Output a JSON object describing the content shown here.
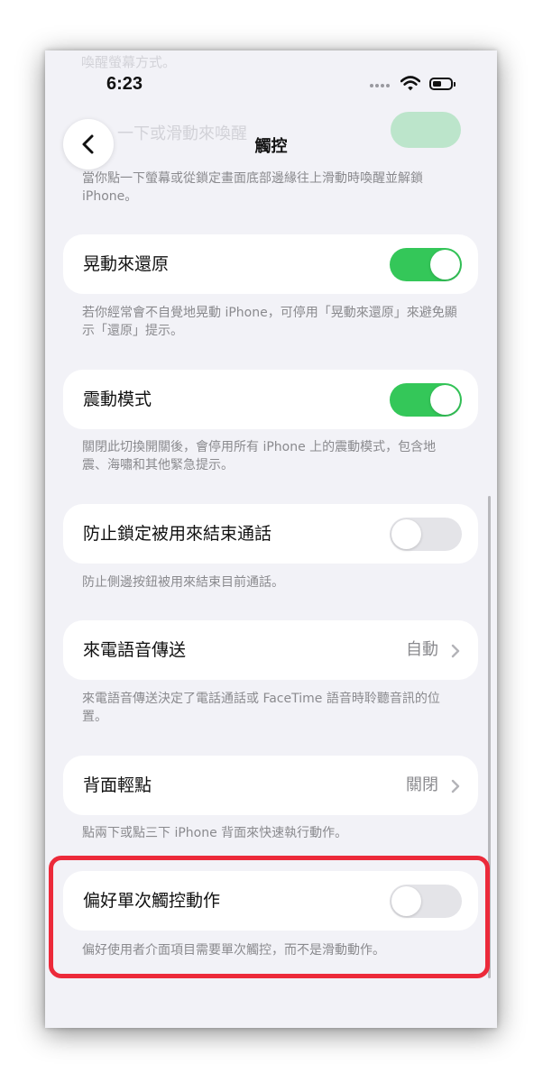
{
  "status_bar": {
    "time": "6:23"
  },
  "nav": {
    "title": "觸控"
  },
  "background_ghost": {
    "line1": "喚醒螢幕方式。",
    "line2": "一下或滑動來喚醒"
  },
  "wake_footer": "當你點一下螢幕或從鎖定畫面底部邊緣往上滑動時喚醒並解鎖 iPhone。",
  "settings": [
    {
      "label": "晃動來還原",
      "control": "toggle",
      "on": true,
      "footer": "若你經常會不自覺地晃動 iPhone，可停用「晃動來還原」來避免顯示「還原」提示。"
    },
    {
      "label": "震動模式",
      "control": "toggle",
      "on": true,
      "footer": "關閉此切換開關後，會停用所有 iPhone 上的震動模式，包含地震、海嘯和其他緊急提示。"
    },
    {
      "label": "防止鎖定被用來結束通話",
      "control": "toggle",
      "on": false,
      "footer": "防止側邊按鈕被用來結束目前通話。"
    },
    {
      "label": "來電語音傳送",
      "control": "disclosure",
      "value": "自動",
      "footer": "來電語音傳送決定了電話通話或 FaceTime 語音時聆聽音訊的位置。"
    },
    {
      "label": "背面輕點",
      "control": "disclosure",
      "value": "關閉",
      "footer": "點兩下或點三下 iPhone 背面來快速執行動作。"
    },
    {
      "label": "偏好單次觸控動作",
      "control": "toggle",
      "on": false,
      "footer": "偏好使用者介面項目需要單次觸控，而不是滑動動作。"
    }
  ],
  "colors": {
    "toggle_on": "#34c759",
    "toggle_off": "#e4e4e8",
    "highlight": "#ec2a3a",
    "background": "#f2f2f7"
  }
}
